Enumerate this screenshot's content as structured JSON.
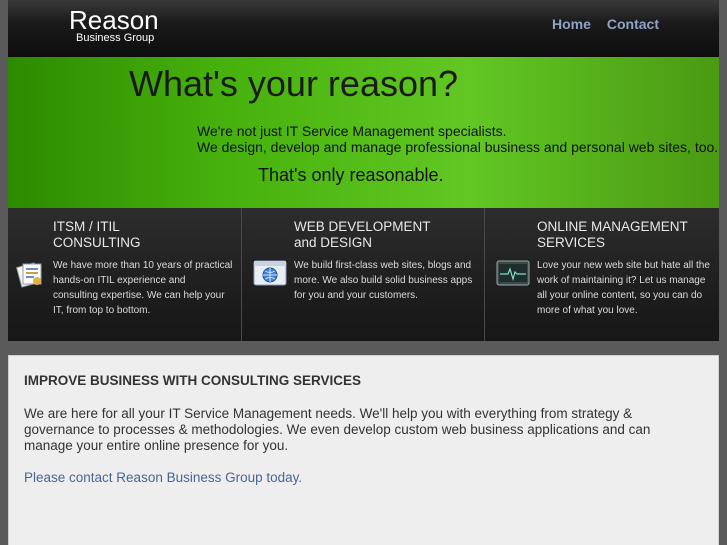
{
  "header": {
    "logo_title": "Reason",
    "logo_subtitle": "Business Group",
    "nav": [
      {
        "label": "Home"
      },
      {
        "label": "Contact"
      }
    ]
  },
  "hero": {
    "title": "What's your reason?",
    "line1": "We're not just IT Service Management specialists.",
    "line2": "We design, develop and manage professional business and personal web sites, too.",
    "tagline": "That's only reasonable."
  },
  "services": [
    {
      "title_line1": "ITSM / ITIL",
      "title_line2": "CONSULTING",
      "body": "We have more than 10 years of practical hands-on ITIL experience and consulting expertise. We can help your IT, from top to bottom.",
      "icon": "documents-icon"
    },
    {
      "title_line1": "WEB DEVELOPMENT",
      "title_line2": "and DESIGN",
      "body": "We build first-class web sites, blogs and more. We also build solid business apps for you and your customers.",
      "icon": "browser-globe-icon"
    },
    {
      "title_line1": "ONLINE MANAGEMENT",
      "title_line2": "SERVICES",
      "body": "Love your new web site but hate all the work of maintaining it? Let us manage all your online content, so you can do more of what you love.",
      "icon": "monitor-pulse-icon"
    }
  ],
  "content": {
    "heading": "IMPROVE BUSINESS WITH CONSULTING SERVICES",
    "body": "We are here for all your IT Service Management needs. We'll help you with everything from strategy & governance to processes & methodologies. We even develop custom web business applications and can manage your entire online presence for you.",
    "link": "Please contact Reason Business Group today."
  },
  "colors": {
    "nav_link": "#8fa3c4",
    "hero_green": "#46b10c",
    "content_link": "#4b6597"
  }
}
